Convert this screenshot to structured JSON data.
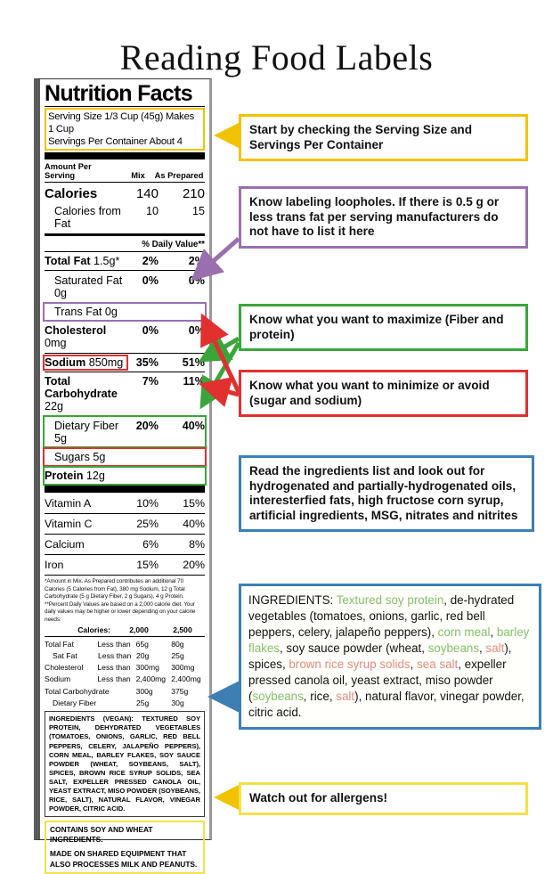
{
  "page": {
    "title": "Reading Food Labels"
  },
  "colors": {
    "yellow": "#f2c200",
    "purple": "#9a6fb0",
    "green": "#3aa63a",
    "red": "#e03030",
    "blue": "#3d7fb5",
    "pale_yellow": "#f2e14a",
    "ing_green": "#86bf6b",
    "ing_red": "#e38b80"
  },
  "label": {
    "heading": "Nutrition Facts",
    "serving_size": "Serving Size 1/3 Cup (45g) Makes 1 Cup",
    "servings_per_container": "Servings Per Container About 4",
    "column_headers": {
      "name": "Amount Per Serving",
      "col1": "Mix",
      "col2": "As Prepared"
    },
    "calories": {
      "name": "Calories",
      "col1": "140",
      "col2": "210"
    },
    "calories_from_fat": {
      "name": "Calories from Fat",
      "col1": "10",
      "col2": "15"
    },
    "daily_value_header": "% Daily Value**",
    "rows": [
      {
        "name": "Total Fat",
        "amount": "1.5g*",
        "col1": "2%",
        "col2": "2%"
      },
      {
        "name": "Saturated Fat 0g",
        "amount": "",
        "col1": "0%",
        "col2": "0%"
      },
      {
        "name": "Trans Fat 0g",
        "amount": "",
        "col1": "",
        "col2": ""
      },
      {
        "name": "Cholesterol",
        "amount": "0mg",
        "col1": "0%",
        "col2": "0%"
      },
      {
        "name": "Sodium",
        "amount": "850mg",
        "col1": "35%",
        "col2": "51%"
      },
      {
        "name": "Total Carbohydrate",
        "amount": "22g",
        "col1": "7%",
        "col2": "11%"
      },
      {
        "name": "Dietary Fiber 5g",
        "amount": "",
        "col1": "20%",
        "col2": "40%"
      },
      {
        "name": "Sugars 5g",
        "amount": "",
        "col1": "",
        "col2": ""
      },
      {
        "name": "Protein",
        "amount": "12g",
        "col1": "",
        "col2": ""
      }
    ],
    "vitamins": [
      {
        "name": "Vitamin A",
        "col1": "10%",
        "col2": "15%"
      },
      {
        "name": "Vitamin C",
        "col1": "25%",
        "col2": "40%"
      },
      {
        "name": "Calcium",
        "col1": "6%",
        "col2": "8%"
      },
      {
        "name": "Iron",
        "col1": "15%",
        "col2": "20%"
      }
    ],
    "footnote": "*Amount in Mix. As Prepared contributes an additional 70 Calories (5 Calories from Fat), 380 mg Sodium, 12 g Total Carbohydrate (5 g Dietary Fiber, 2 g Sugars), 4 g Protein. **Percent Daily Values are based on a 2,000 calorie diet. Your daily values may be higher or lower depending on your calorie needs:",
    "dv_table_header": {
      "label": "Calories:",
      "col_a": "2,000",
      "col_b": "2,500"
    },
    "dv_table_rows": [
      {
        "name": "Total Fat",
        "qualifier": "Less than",
        "a": "65g",
        "b": "80g",
        "indent": false
      },
      {
        "name": "Sat Fat",
        "qualifier": "Less than",
        "a": "20g",
        "b": "25g",
        "indent": true
      },
      {
        "name": "Cholesterol",
        "qualifier": "Less than",
        "a": "300mg",
        "b": "300mg",
        "indent": false
      },
      {
        "name": "Sodium",
        "qualifier": "Less than",
        "a": "2,400mg",
        "b": "2,400mg",
        "indent": false
      },
      {
        "name": "Total Carbohydrate",
        "qualifier": "",
        "a": "300g",
        "b": "375g",
        "indent": false
      },
      {
        "name": "Dietary Fiber",
        "qualifier": "",
        "a": "25g",
        "b": "30g",
        "indent": true
      }
    ],
    "ingredients_text": "INGREDIENTS (VEGAN): TEXTURED SOY PROTEIN, DEHYDRATED VEGETABLES (TOMATOES, ONIONS, GARLIC, RED BELL PEPPERS, CELERY, JALAPEÑO PEPPERS), CORN MEAL, BARLEY FLAKES, SOY SAUCE POWDER (WHEAT, SOYBEANS, SALT), SPICES, BROWN RICE SYRUP SOLIDS, SEA SALT, EXPELLER PRESSED CANOLA OIL, YEAST EXTRACT, MISO POWDER (SOYBEANS, RICE, SALT), NATURAL FLAVOR, VINEGAR POWDER, CITRIC ACID.",
    "allergen_contains": "CONTAINS SOY AND WHEAT INGREDIENTS.",
    "allergen_shared": "MADE ON SHARED EQUIPMENT THAT ALSO PROCESSES MILK AND PEANUTS."
  },
  "callouts": {
    "serving": "Start by checking the Serving Size and Servings Per Container",
    "transfat": "Know labeling loopholes. If there is 0.5 g or less trans fat per serving manufacturers do not have to list it here",
    "maximize": "Know what you want to maximize (Fiber and protein)",
    "minimize": "Know what you want to minimize or avoid (sugar and sodium)",
    "ingredients_advice": "Read the ingredients list and look out for hydrogenated and partially-hydrogenated oils, interesterfied fats, high fructose corn syrup, artificial ingredients, MSG, nitrates and nitrites",
    "allergens": "Watch out for allergens!"
  },
  "ingredients_panel": {
    "label": "INGREDIENTS:",
    "segments": [
      {
        "text": " Textured soy protein",
        "color": "green"
      },
      {
        "text": ", de-hydrated vegetables (tomatoes, onions, garlic, red bell peppers, celery, jalapeño peppers), ",
        "color": "none"
      },
      {
        "text": "corn meal",
        "color": "green"
      },
      {
        "text": ", ",
        "color": "none"
      },
      {
        "text": "barley flakes",
        "color": "green"
      },
      {
        "text": ", soy sauce powder (wheat, ",
        "color": "none"
      },
      {
        "text": "soybeans",
        "color": "green"
      },
      {
        "text": ", ",
        "color": "none"
      },
      {
        "text": "salt",
        "color": "red"
      },
      {
        "text": "), spices, ",
        "color": "none"
      },
      {
        "text": "brown rice syrup solids",
        "color": "red"
      },
      {
        "text": ", ",
        "color": "none"
      },
      {
        "text": "sea salt",
        "color": "red"
      },
      {
        "text": ", expeller pressed canola oil, yeast extract, miso powder (",
        "color": "none"
      },
      {
        "text": "soybeans",
        "color": "green"
      },
      {
        "text": ", rice, ",
        "color": "none"
      },
      {
        "text": "salt",
        "color": "red"
      },
      {
        "text": "), natural flavor, vinegar powder, citric acid.",
        "color": "none"
      }
    ]
  }
}
